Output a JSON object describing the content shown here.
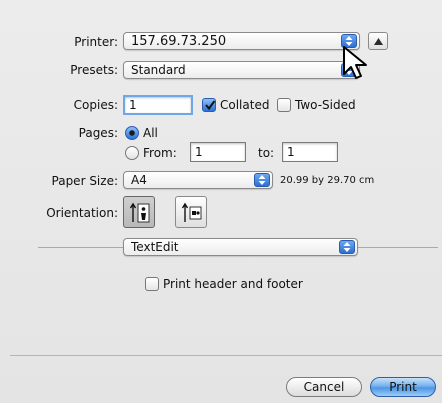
{
  "printer": {
    "label": "Printer:",
    "value": "157.69.73.250"
  },
  "presets": {
    "label": "Presets:",
    "value": "Standard"
  },
  "copies": {
    "label": "Copies:",
    "value": "1",
    "collated_label": "Collated",
    "collated": true,
    "two_sided_label": "Two-Sided",
    "two_sided": false
  },
  "pages": {
    "label": "Pages:",
    "all_label": "All",
    "from_label": "From:",
    "from_value": "1",
    "to_label": "to:",
    "to_value": "1",
    "selected": "All"
  },
  "paper": {
    "label": "Paper Size:",
    "value": "A4",
    "dimensions": "20.99 by 29.70 cm"
  },
  "orientation": {
    "label": "Orientation:",
    "options": [
      "portrait",
      "landscape"
    ],
    "selected": "portrait"
  },
  "section": {
    "value": "TextEdit"
  },
  "header_footer": {
    "label": "Print header and footer",
    "checked": false
  },
  "buttons": {
    "cancel": "Cancel",
    "print": "Print"
  },
  "colors": {
    "accent": "#2b6fd6",
    "background": "#e8e8e8"
  },
  "icons": [
    "disclosure-triangle-icon",
    "popup-arrows-icon",
    "cursor-arrow-icon",
    "portrait-orientation-icon",
    "landscape-orientation-icon"
  ]
}
